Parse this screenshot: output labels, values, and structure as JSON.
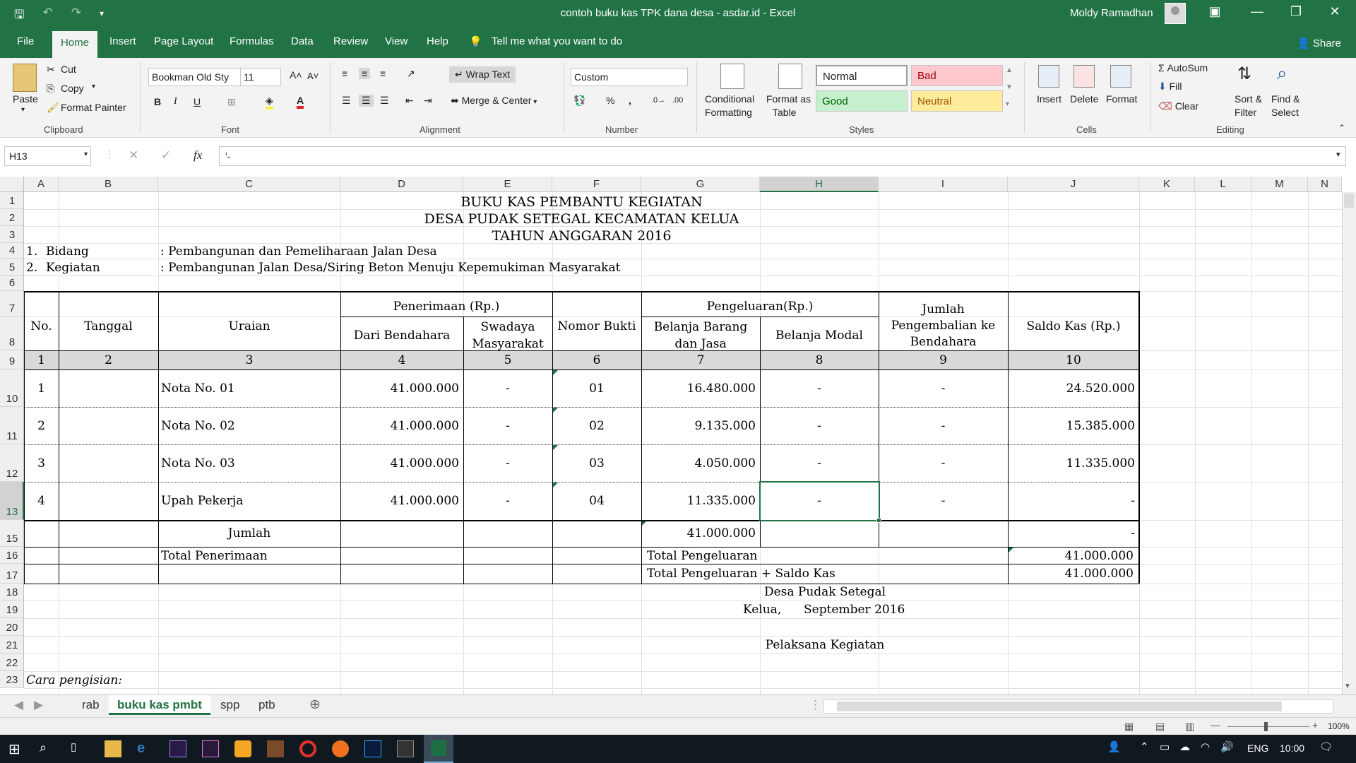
{
  "titlebar": {
    "title": "contoh buku kas TPK dana desa - asdar.id  -  Excel",
    "user": "Moldy Ramadhan"
  },
  "menu": {
    "file": "File",
    "home": "Home",
    "insert": "Insert",
    "page_layout": "Page Layout",
    "formulas": "Formulas",
    "data": "Data",
    "review": "Review",
    "view": "View",
    "help": "Help",
    "tell_me": "Tell me what you want to do",
    "share": "Share"
  },
  "ribbon": {
    "paste": "Paste",
    "cut": "Cut",
    "copy": "Copy",
    "format_painter": "Format Painter",
    "clipboard": "Clipboard",
    "font_name": "Bookman Old Sty",
    "font_size": "11",
    "font": "Font",
    "wrap_text": "Wrap Text",
    "merge_center": "Merge & Center",
    "alignment": "Alignment",
    "number_format": "Custom",
    "number": "Number",
    "conditional_formatting_1": "Conditional",
    "conditional_formatting_2": "Formatting",
    "format_as_table_1": "Format as",
    "format_as_table_2": "Table",
    "style_normal": "Normal",
    "style_bad": "Bad",
    "style_good": "Good",
    "style_neutral": "Neutral",
    "styles": "Styles",
    "insert": "Insert",
    "delete": "Delete",
    "format": "Format",
    "cells": "Cells",
    "autosum": "AutoSum",
    "fill": "Fill",
    "clear": "Clear",
    "sort_filter_1": "Sort &",
    "sort_filter_2": "Filter",
    "find_select_1": "Find &",
    "find_select_2": "Select",
    "editing": "Editing"
  },
  "formula_bar": {
    "name_box": "H13",
    "formula": "'-"
  },
  "columns": [
    "A",
    "B",
    "C",
    "D",
    "E",
    "F",
    "G",
    "H",
    "I",
    "J",
    "K",
    "L",
    "M",
    "N"
  ],
  "rows": [
    "1",
    "2",
    "3",
    "4",
    "5",
    "6",
    "7",
    "8",
    "9",
    "10",
    "11",
    "12",
    "13",
    "15",
    "16",
    "17",
    "18",
    "19",
    "20",
    "21",
    "22",
    "23"
  ],
  "sheet": {
    "title1": "BUKU KAS PEMBANTU KEGIATAN",
    "title2": "DESA PUDAK SETEGAL KECAMATAN KELUA",
    "title3": "TAHUN ANGGARAN 2016",
    "bidang_no": "1.",
    "bidang_label": "Bidang",
    "bidang_value": ": Pembangunan dan Pemeliharaan Jalan Desa",
    "kegiatan_no": "2.",
    "kegiatan_label": "Kegiatan",
    "kegiatan_value": ": Pembangunan Jalan Desa/Siring Beton Menuju Kepemukiman Masyarakat",
    "h_no": "No.",
    "h_tanggal": "Tanggal",
    "h_uraian": "Uraian",
    "h_penerimaan": "Penerimaan (Rp.)",
    "h_dari_bendahara": "Dari Bendahara",
    "h_swadaya_1": "Swadaya",
    "h_swadaya_2": "Masyarakat",
    "h_nomor_bukti": "Nomor Bukti",
    "h_pengeluaran": "Pengeluaran(Rp.)",
    "h_belanja_barang_1": "Belanja Barang",
    "h_belanja_barang_2": "dan Jasa",
    "h_belanja_modal": "Belanja Modal",
    "h_jumlah_1": "Jumlah",
    "h_jumlah_2": "Pengembalian ke",
    "h_jumlah_3": "Bendahara",
    "h_saldo": "Saldo Kas (Rp.)",
    "colnums": [
      "1",
      "2",
      "3",
      "4",
      "5",
      "6",
      "7",
      "8",
      "9",
      "10"
    ],
    "data_rows": [
      {
        "no": "1",
        "uraian": "Nota No. 01",
        "dari": "41.000.000",
        "swadaya": "-",
        "bukti": "01",
        "barang": "16.480.000",
        "modal": "-",
        "jumlah": "-",
        "saldo": "24.520.000"
      },
      {
        "no": "2",
        "uraian": "Nota No. 02",
        "dari": "41.000.000",
        "swadaya": "-",
        "bukti": "02",
        "barang": "9.135.000",
        "modal": "-",
        "jumlah": "-",
        "saldo": "15.385.000"
      },
      {
        "no": "3",
        "uraian": "Nota No. 03",
        "dari": "41.000.000",
        "swadaya": "-",
        "bukti": "03",
        "barang": "4.050.000",
        "modal": "-",
        "jumlah": "-",
        "saldo": "11.335.000"
      },
      {
        "no": "4",
        "uraian": "Upah Pekerja",
        "dari": "41.000.000",
        "swadaya": "-",
        "bukti": "04",
        "barang": "11.335.000",
        "modal": "-",
        "jumlah": "-",
        "saldo": "-"
      }
    ],
    "jumlah_label": "Jumlah",
    "jumlah_barang": "41.000.000",
    "jumlah_saldo": "-",
    "total_penerimaan": "Total Penerimaan",
    "total_pengeluaran": "Total Pengeluaran",
    "total_pengeluaran_value": "41.000.000",
    "total_plus_saldo": "Total Pengeluaran + Saldo Kas",
    "total_plus_saldo_value": "41.000.000",
    "desa": "Desa Pudak Setegal",
    "kelua": "Kelua,",
    "date": "September 2016",
    "pelaksana": "Pelaksana Kegiatan",
    "cara_pengisian": "Cara pengisian:"
  },
  "sheet_tabs": [
    "rab",
    "buku kas pmbt",
    "spp",
    "ptb"
  ],
  "status": {
    "zoom": "100%"
  },
  "taskbar": {
    "lang": "ENG",
    "time": "10:00"
  }
}
